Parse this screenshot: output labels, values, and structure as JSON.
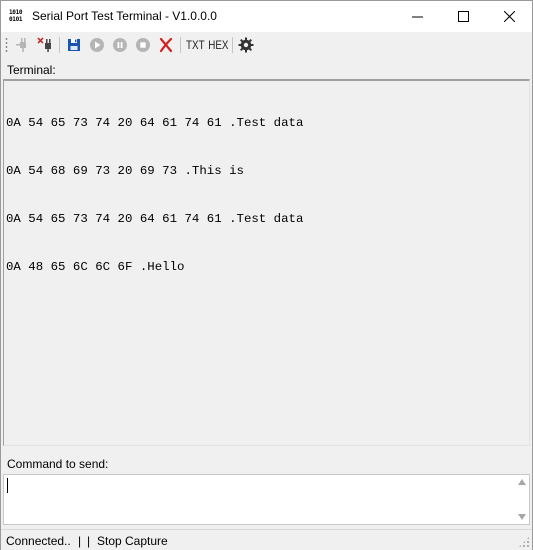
{
  "window": {
    "title": "Serial Port Test Terminal - V1.0.0.0",
    "icon_text_top": "1010",
    "icon_text_bottom": "0101",
    "controls": [
      "minimize-icon",
      "maximize-icon",
      "close-icon"
    ]
  },
  "toolbar": {
    "items": [
      {
        "name": "connect",
        "icon": "plug-connect-icon",
        "enabled": false
      },
      {
        "name": "disconnect",
        "icon": "plug-disconnect-icon",
        "enabled": true
      },
      {
        "name": "save",
        "icon": "floppy-save-icon",
        "enabled": true
      },
      {
        "name": "play",
        "icon": "play-icon",
        "enabled": false
      },
      {
        "name": "pause",
        "icon": "pause-icon",
        "enabled": false
      },
      {
        "name": "stop",
        "icon": "stop-icon",
        "enabled": false
      },
      {
        "name": "clear",
        "icon": "red-x-clear-icon",
        "enabled": true
      },
      {
        "name": "settings",
        "icon": "gear-icon",
        "enabled": true
      }
    ],
    "txt_label": "TXT",
    "hex_label": "HEX",
    "colors": {
      "save": "#1a56b0",
      "clear": "#d21f1f",
      "disabled": "#b5b5b5"
    }
  },
  "terminal": {
    "label": "Terminal:",
    "lines": [
      "0A 54 65 73 74 20 64 61 74 61 .Test data",
      "0A 54 68 69 73 20 69 73 .This is",
      "0A 54 65 73 74 20 64 61 74 61 .Test data",
      "0A 48 65 6C 6C 6F .Hello"
    ]
  },
  "command": {
    "label": "Command to send:",
    "value": ""
  },
  "status": {
    "connection": "Connected..",
    "sep1": "|",
    "sep2": "|",
    "capture": "Stop Capture"
  }
}
